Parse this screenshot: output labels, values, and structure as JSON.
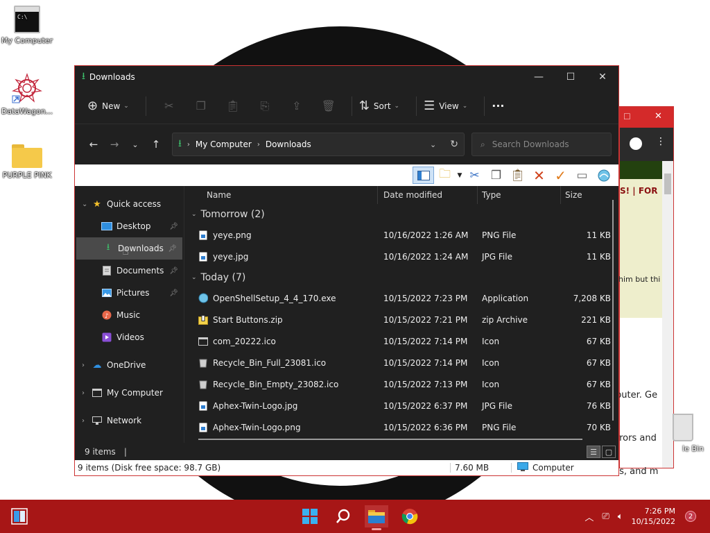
{
  "desktop": {
    "icons": [
      {
        "label": "My Computer"
      },
      {
        "label": "DataWagon..."
      },
      {
        "label": "PURPLE PINK"
      }
    ],
    "recycle_partial_label": "le Bin"
  },
  "browser_bg": {
    "text_lines": [
      "S! | FOR",
      "him but thi",
      "puter. Ge",
      "rrors and",
      "ts, and m"
    ]
  },
  "explorer": {
    "title": "Downloads",
    "window_buttons": {
      "minimize": "—",
      "maximize": "☐",
      "close": "✕"
    },
    "command_bar": {
      "new_label": "New",
      "sort_label": "Sort",
      "view_label": "View",
      "more_label": "···"
    },
    "address": {
      "crumbs": [
        "My Computer",
        "Downloads"
      ]
    },
    "search": {
      "placeholder": "Search Downloads"
    },
    "sidebar": {
      "quick_access": "Quick access",
      "items": [
        {
          "label": "Desktop"
        },
        {
          "label": "Downloads"
        },
        {
          "label": "Documents"
        },
        {
          "label": "Pictures"
        },
        {
          "label": "Music"
        },
        {
          "label": "Videos"
        }
      ],
      "onedrive": "OneDrive",
      "my_computer": "My Computer",
      "network": "Network"
    },
    "columns": {
      "name": "Name",
      "date": "Date modified",
      "type": "Type",
      "size": "Size"
    },
    "groups": [
      {
        "label": "Tomorrow (2)",
        "files": [
          {
            "name": "yeye.png",
            "date": "10/16/2022 1:26 AM",
            "type": "PNG File",
            "size": "11 KB"
          },
          {
            "name": "yeye.jpg",
            "date": "10/16/2022 1:24 AM",
            "type": "JPG File",
            "size": "11 KB"
          }
        ]
      },
      {
        "label": "Today (7)",
        "files": [
          {
            "name": "OpenShellSetup_4_4_170.exe",
            "date": "10/15/2022 7:23 PM",
            "type": "Application",
            "size": "7,208 KB"
          },
          {
            "name": "Start Buttons.zip",
            "date": "10/15/2022 7:21 PM",
            "type": "zip Archive",
            "size": "221 KB"
          },
          {
            "name": "com_20222.ico",
            "date": "10/15/2022 7:14 PM",
            "type": "Icon",
            "size": "67 KB"
          },
          {
            "name": "Recycle_Bin_Full_23081.ico",
            "date": "10/15/2022 7:14 PM",
            "type": "Icon",
            "size": "67 KB"
          },
          {
            "name": "Recycle_Bin_Empty_23082.ico",
            "date": "10/15/2022 7:13 PM",
            "type": "Icon",
            "size": "67 KB"
          },
          {
            "name": "Aphex-Twin-Logo.jpg",
            "date": "10/15/2022 6:37 PM",
            "type": "JPG File",
            "size": "76 KB"
          },
          {
            "name": "Aphex-Twin-Logo.png",
            "date": "10/15/2022 6:36 PM",
            "type": "PNG File",
            "size": "70 KB"
          }
        ]
      }
    ],
    "status": {
      "items_count": "9 items",
      "bottom_left": "9 items (Disk free space: 98.7 GB)",
      "bottom_size": "7.60 MB",
      "bottom_location": "Computer"
    }
  },
  "taskbar": {
    "time": "7:26 PM",
    "date": "10/15/2022",
    "notification_count": "2"
  }
}
